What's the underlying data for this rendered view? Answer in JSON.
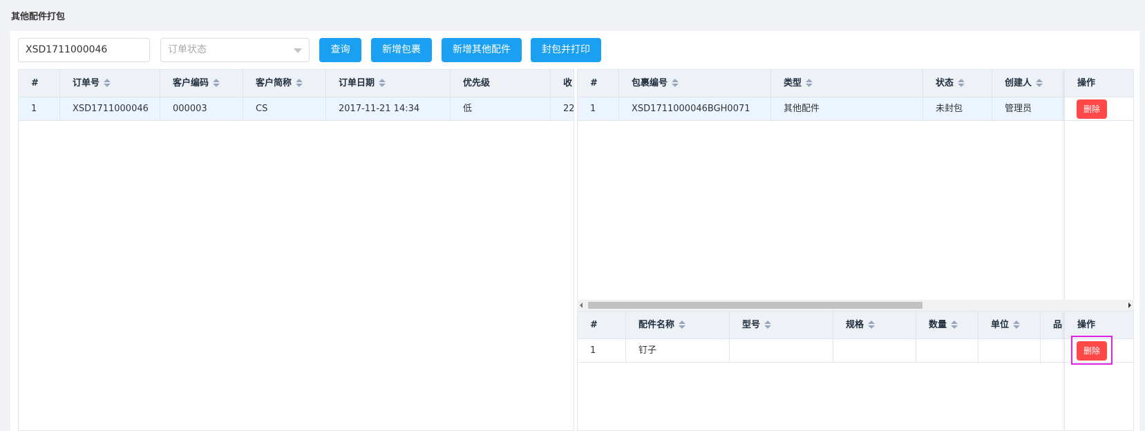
{
  "page": {
    "title": "其他配件打包"
  },
  "toolbar": {
    "order_no_value": "XSD1711000046",
    "status_placeholder": "订单状态",
    "query_label": "查询",
    "add_package_label": "新增包裹",
    "add_other_parts_label": "新增其他配件",
    "seal_print_label": "封包并打印"
  },
  "orders_table": {
    "headers": [
      "#",
      "订单号",
      "客户编码",
      "客户简称",
      "订单日期",
      "优先级",
      "收"
    ],
    "rows": [
      [
        "1",
        "XSD1711000046",
        "000003",
        "CS",
        "2017-11-21 14:34",
        "低",
        "22"
      ]
    ]
  },
  "packages_table": {
    "headers": [
      "#",
      "包裹编号",
      "类型",
      "状态",
      "创建人"
    ],
    "action_header": "操作",
    "rows": [
      [
        "1",
        "XSD1711000046BGH0071",
        "其他配件",
        "未封包",
        "管理员"
      ]
    ],
    "delete_label": "删除"
  },
  "parts_table": {
    "headers": [
      "#",
      "配件名称",
      "型号",
      "规格",
      "数量",
      "单位",
      "品"
    ],
    "action_header": "操作",
    "rows": [
      [
        "1",
        "钉子",
        "",
        "",
        "",
        "",
        ""
      ]
    ],
    "delete_label": "删除"
  },
  "colors": {
    "primary": "#1aa0f0",
    "danger": "#ff4949",
    "highlight": "#ecf5ff",
    "focus": "#e020e0"
  }
}
